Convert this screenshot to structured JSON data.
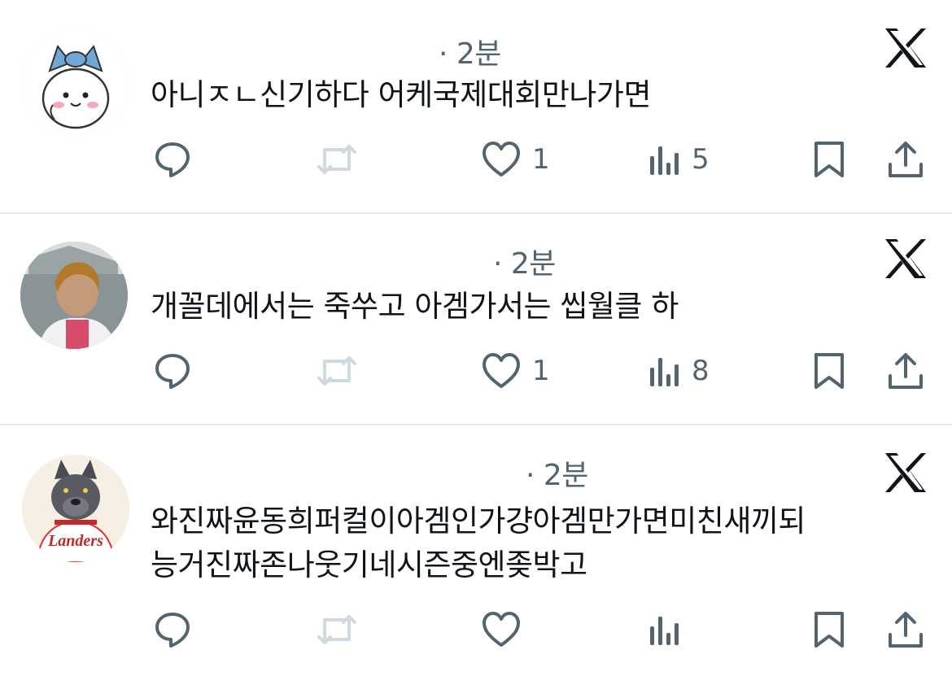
{
  "posts": [
    {
      "time": "· 2분",
      "text_lines": [
        "아니ㅈㄴ신기하다 어케국제대회만나가면"
      ],
      "avatar": "white-cat-character-with-blue-bow",
      "actions": {
        "reply": "",
        "repost": "",
        "like": "1",
        "views": "5"
      }
    },
    {
      "time": "· 2분",
      "text_lines": [
        "개꼴데에서는 죽쑤고 아겜가서는 씹월클 하"
      ],
      "avatar": "person-photo",
      "actions": {
        "reply": "",
        "repost": "",
        "like": "1",
        "views": "8"
      }
    },
    {
      "time": "· 2분",
      "text_lines": [
        "와진짜윤동희퍼컬이아겜인가걍아겜만가면미친새끼되",
        "능거진짜존나웃기네시즌중엔좆박고"
      ],
      "avatar": "dog-mascot-in-landers-jersey",
      "avatar_text": "Landers",
      "actions": {
        "reply": "",
        "repost": "",
        "like": "",
        "views": ""
      }
    }
  ],
  "icons": {
    "reply": "reply-bubble-icon",
    "repost": "repost-icon",
    "like": "heart-icon",
    "views": "views-bar-icon",
    "bookmark": "bookmark-icon",
    "share": "share-icon",
    "platform": "x-logo-icon"
  },
  "colors": {
    "text": "#0f1419",
    "muted": "#536471",
    "repost_disabled": "#cfd9de",
    "divider": "#e6e9ec"
  }
}
